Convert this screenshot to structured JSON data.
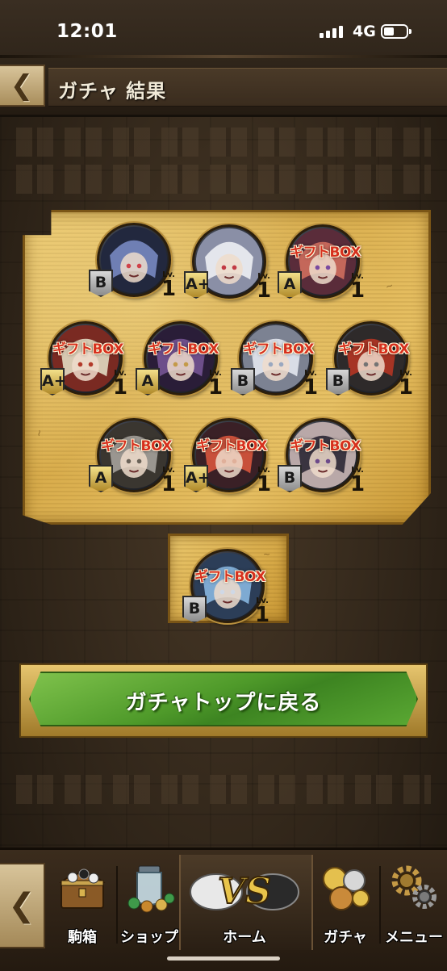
{
  "status_bar": {
    "time": "12:01",
    "network": "4G"
  },
  "header": {
    "title": "ガチャ 結果"
  },
  "results": [
    {
      "overlay": "",
      "rank": "B",
      "level_label": "Lv.",
      "level": "1",
      "portrait": "blue-dragon"
    },
    {
      "overlay": "",
      "rank": "A+",
      "level_label": "Lv.",
      "level": "1",
      "portrait": "white-hair-glasses"
    },
    {
      "overlay": "ギフトBOX",
      "rank": "A",
      "level_label": "Lv.",
      "level": "1",
      "portrait": "red-hair-horns"
    },
    {
      "overlay": "ギフトBOX",
      "rank": "A+",
      "level_label": "Lv.",
      "level": "1",
      "portrait": "white-hair-red-hat"
    },
    {
      "overlay": "ギフトBOX",
      "rank": "A",
      "level_label": "Lv.",
      "level": "1",
      "portrait": "purple-armored"
    },
    {
      "overlay": "ギフトBOX",
      "rank": "B",
      "level_label": "Lv.",
      "level": "1",
      "portrait": "white-spirit"
    },
    {
      "overlay": "ギフトBOX",
      "rank": "B",
      "level_label": "Lv.",
      "level": "1",
      "portrait": "red-knight"
    },
    {
      "overlay": "ギフトBOX",
      "rank": "A",
      "level_label": "Lv.",
      "level": "1",
      "portrait": "grey-masked"
    },
    {
      "overlay": "ギフトBOX",
      "rank": "A+",
      "level_label": "Lv.",
      "level": "1",
      "portrait": "red-hair-smile"
    },
    {
      "overlay": "ギフトBOX",
      "rank": "B",
      "level_label": "Lv.",
      "level": "1",
      "portrait": "dark-hair-girl"
    },
    {
      "overlay": "ギフトBOX",
      "rank": "B",
      "level_label": "Lv.",
      "level": "1",
      "portrait": "blue-hair"
    }
  ],
  "primary_action": {
    "label": "ガチャトップに戻る"
  },
  "bottom_nav": [
    {
      "label": "駒箱",
      "icon": "treasure-chest-icon"
    },
    {
      "label": "ショップ",
      "icon": "shop-jar-icon"
    },
    {
      "label": "ホーム",
      "icon": "vs-home-icon"
    },
    {
      "label": "ガチャ",
      "icon": "gacha-coins-icon"
    },
    {
      "label": "メニュー",
      "icon": "gears-icon"
    }
  ],
  "colors": {
    "gift_text": "#d6301e",
    "panel_gold": "#e2b95a",
    "button_green": "#4f9a2a",
    "frame_brown": "#3a2c1e"
  }
}
